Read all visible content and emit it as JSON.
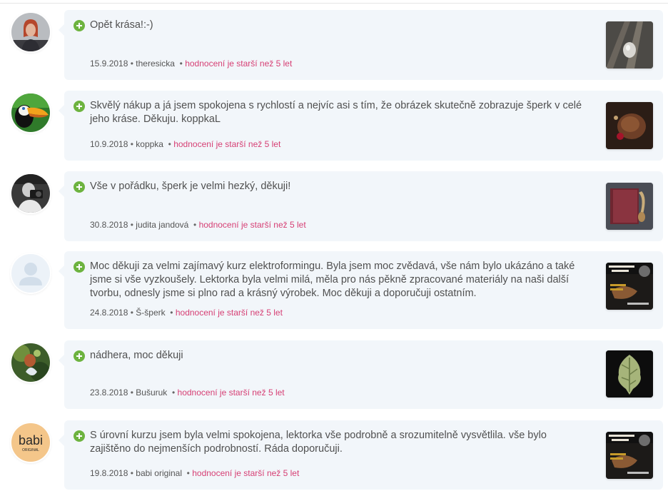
{
  "reviews": [
    {
      "avatar_icon": "woman-portrait-avatar",
      "text": "Opět krása!:-)",
      "date": "15.9.2018",
      "author": "theresicka",
      "age_note": "hodnocení je starší než 5 let",
      "thumb_icon": "pendant-on-rails-photo"
    },
    {
      "avatar_icon": "toucan-avatar",
      "text": "Skvělý nákup a já jsem spokojena s rychlostí a nejvíc asi s tím, že obrázek skutečně zobrazuje šperk v celé jeho kráse. Děkuju. koppkaL",
      "date": "10.9.2018",
      "author": "koppka",
      "age_note": "hodnocení je starší než 5 let",
      "thumb_icon": "walnut-pendant-photo"
    },
    {
      "avatar_icon": "person-photographer-avatar",
      "text": "Vše v pořádku, šperk je velmi hezký, děkuji!",
      "date": "30.8.2018",
      "author": "judita jandová",
      "age_note": "hodnocení je starší než 5 let",
      "thumb_icon": "book-with-pendant-photo"
    },
    {
      "avatar_icon": "default-user-avatar",
      "text": "Moc děkuji za velmi zajímavý kurz elektroformingu. Byla jsem moc zvědavá, vše nám bylo ukázáno a také jsme si vše vyzkoušely. Lektorka byla velmi milá, měla pro nás pěkně zpracované materiály na naši další tvorbu, odnesly jsme si plno rad a krásný výrobek. Moc děkuji a doporučuji ostatním.",
      "date": "24.8.2018",
      "author": "Š-šperk",
      "age_note": "hodnocení je starší než 5 let",
      "thumb_icon": "electroforming-course-poster"
    },
    {
      "avatar_icon": "nature-avatar",
      "text": "nádhera, moc děkuji",
      "date": "23.8.2018",
      "author": "Bušuruk",
      "age_note": "hodnocení je starší než 5 let",
      "thumb_icon": "green-leaf-pendant-photo"
    },
    {
      "avatar_icon": "babi-original-logo-avatar",
      "avatar_logo_text": "babi",
      "avatar_logo_sub": "ORIGINAL",
      "text": "S úrovní kurzu jsem byla velmi spokojena, lektorka vše podrobně a srozumitelně vysvětlila. vše bylo zajištěno do nejmenších podrobností. Ráda doporučuji.",
      "date": "19.8.2018",
      "author": "babi original",
      "age_note": "hodnocení je starší než 5 let",
      "thumb_icon": "electroforming-course-poster"
    }
  ],
  "colors": {
    "bubble_bg": "#f2f6fa",
    "positive_badge": "#6db33f",
    "age_note": "#d63f74",
    "text": "#505050"
  }
}
